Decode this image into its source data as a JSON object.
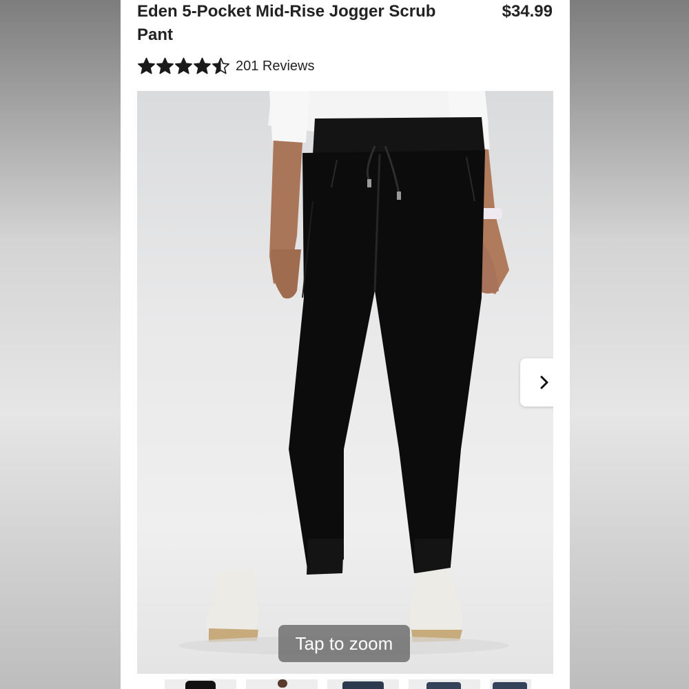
{
  "product": {
    "title": "Eden 5-Pocket Mid-Rise Jogger Scrub Pant",
    "price": "$34.99",
    "rating": 4.5,
    "rating_max": 5,
    "reviews": "201 Reviews"
  },
  "gallery": {
    "zoom_label": "Tap to zoom",
    "next_icon": "chevron-right-icon",
    "thumbnail_count": 5
  },
  "colors": {
    "star": "#1a1a1a",
    "pant": "#0c0c0c",
    "background": "#ffffff"
  }
}
